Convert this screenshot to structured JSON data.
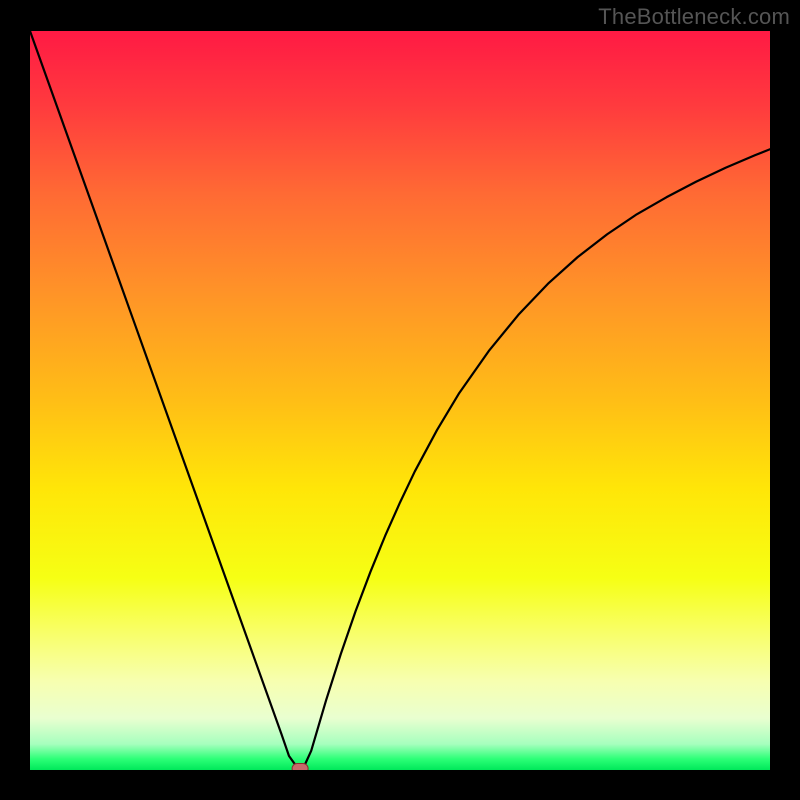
{
  "watermark": "TheBottleneck.com",
  "chart_data": {
    "type": "line",
    "title": "",
    "xlabel": "",
    "ylabel": "",
    "xlim": [
      0,
      100
    ],
    "ylim": [
      0,
      100
    ],
    "grid": false,
    "legend": false,
    "x": [
      0,
      2,
      4,
      6,
      8,
      10,
      12,
      14,
      16,
      18,
      20,
      22,
      24,
      26,
      28,
      30,
      32,
      34,
      35,
      36,
      36.5,
      37,
      38,
      39,
      40,
      42,
      44,
      46,
      48,
      50,
      52,
      55,
      58,
      62,
      66,
      70,
      74,
      78,
      82,
      86,
      90,
      94,
      98,
      100
    ],
    "values": [
      100,
      94.4,
      88.8,
      83.2,
      77.6,
      72,
      66.4,
      60.8,
      55.2,
      49.6,
      44,
      38.4,
      32.8,
      27.2,
      21.6,
      16,
      10.4,
      4.8,
      1.9,
      0.5,
      0.2,
      0.4,
      2.6,
      6.0,
      9.4,
      15.7,
      21.5,
      26.8,
      31.7,
      36.2,
      40.4,
      46.0,
      51.0,
      56.7,
      61.6,
      65.8,
      69.4,
      72.5,
      75.2,
      77.5,
      79.6,
      81.5,
      83.2,
      84.0
    ],
    "marker": {
      "x": 36.5,
      "y": 0.2
    }
  },
  "colors": {
    "frame": "#000000",
    "curve": "#000000",
    "marker_fill": "#c76a6a",
    "marker_stroke": "#8a2e2e",
    "gradient_stops": [
      {
        "offset": 0.0,
        "color": "#ff1a44"
      },
      {
        "offset": 0.1,
        "color": "#ff3a3e"
      },
      {
        "offset": 0.22,
        "color": "#ff6a34"
      },
      {
        "offset": 0.35,
        "color": "#ff9228"
      },
      {
        "offset": 0.5,
        "color": "#ffbe16"
      },
      {
        "offset": 0.62,
        "color": "#ffe608"
      },
      {
        "offset": 0.74,
        "color": "#f6ff14"
      },
      {
        "offset": 0.82,
        "color": "#f8ff6f"
      },
      {
        "offset": 0.88,
        "color": "#f7ffb0"
      },
      {
        "offset": 0.93,
        "color": "#e9ffd0"
      },
      {
        "offset": 0.965,
        "color": "#a6ffbe"
      },
      {
        "offset": 0.985,
        "color": "#2cff77"
      },
      {
        "offset": 1.0,
        "color": "#00e85a"
      }
    ]
  }
}
